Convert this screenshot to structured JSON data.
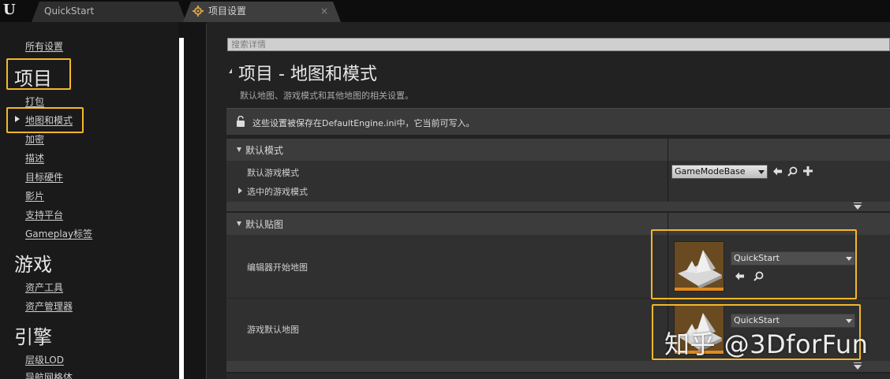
{
  "tabs": [
    {
      "label": "QuickStart"
    },
    {
      "label": "项目设置",
      "close": "×"
    }
  ],
  "search": {
    "placeholder": "搜索详情"
  },
  "nav": {
    "all_settings": "所有设置",
    "categories": [
      {
        "title": "项目",
        "items": [
          "打包",
          "地图和模式",
          "加密",
          "描述",
          "目标硬件",
          "影片",
          "支持平台",
          "Gameplay标签"
        ]
      },
      {
        "title": "游戏",
        "items": [
          "资产工具",
          "资产管理器"
        ]
      },
      {
        "title": "引擎",
        "items": [
          "层级LOD",
          "导航网格体"
        ]
      }
    ],
    "selected": "地图和模式"
  },
  "page": {
    "title": "项目 - 地图和模式",
    "subtitle": "默认地图、游戏模式和其他地图的相关设置。",
    "notice": "这些设置被保存在DefaultEngine.ini中，它当前可写入。"
  },
  "sections": {
    "default_modes": {
      "header": "默认模式",
      "default_game_mode_label": "默认游戏模式",
      "default_game_mode_value": "GameModeBase",
      "selected_game_mode_label": "选中的游戏模式"
    },
    "default_maps": {
      "header": "默认贴图",
      "editor_startup_map_label": "编辑器开始地图",
      "editor_startup_map_value": "QuickStart",
      "game_default_map_label": "游戏默认地图",
      "game_default_map_value": "QuickStart"
    }
  },
  "watermark": "知乎 @3DforFun",
  "colors": {
    "highlight": "#f5b72a",
    "thumbnail_bar": "#e08a1e"
  }
}
